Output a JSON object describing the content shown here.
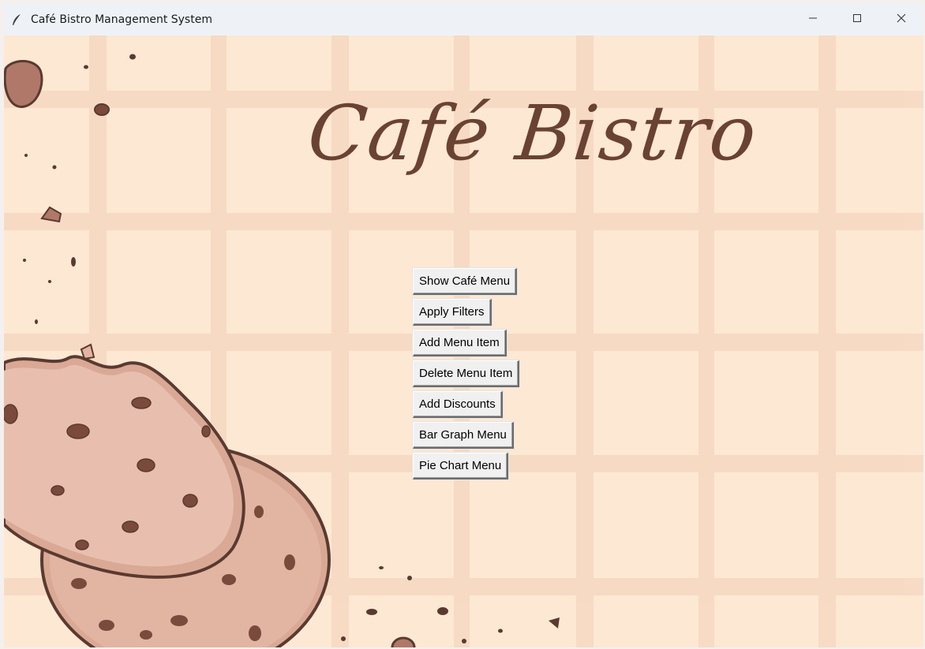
{
  "window": {
    "title": "Café Bistro Management System",
    "icon": "feather-icon"
  },
  "controls": {
    "minimize_icon": "minimize-icon",
    "maximize_icon": "maximize-icon",
    "close_icon": "close-icon"
  },
  "brand": {
    "text": "Café Bistro"
  },
  "menu": {
    "buttons": [
      {
        "label": "Show Café Menu"
      },
      {
        "label": "Apply Filters"
      },
      {
        "label": "Add Menu Item"
      },
      {
        "label": "Delete Menu Item"
      },
      {
        "label": "Add Discounts"
      },
      {
        "label": "Bar Graph Menu"
      },
      {
        "label": "Pie Chart Menu"
      }
    ]
  },
  "colors": {
    "background": "#fde8d4",
    "grid_lines": "#f6d9c2",
    "brand": "#6a4233",
    "cookie": "#e2b5a2",
    "cookie_edge": "#5a3a30",
    "chip": "#7a4a3c"
  }
}
